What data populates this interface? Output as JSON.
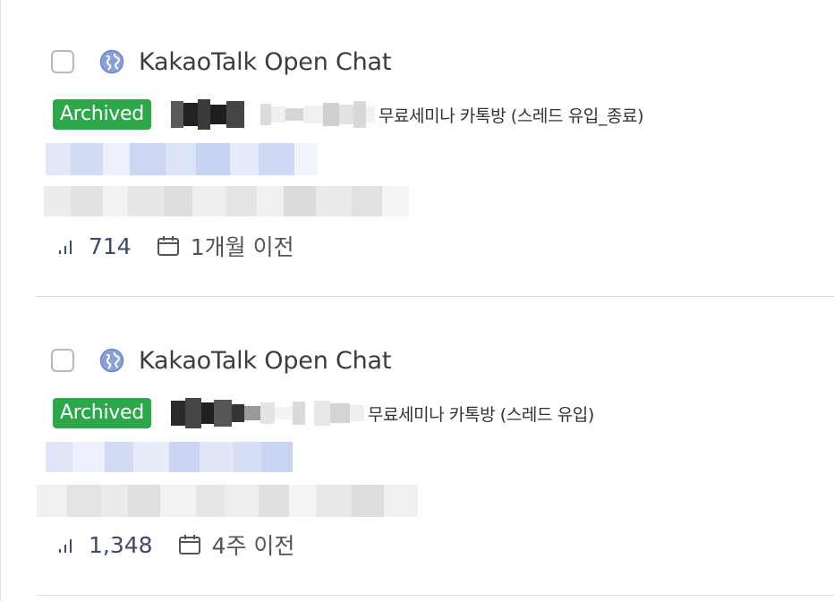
{
  "results": [
    {
      "source": "KakaoTalk Open Chat",
      "badge": "Archived",
      "title_suffix": "무료세미나 카톡방 (스레드 유입_종료)",
      "views": "714",
      "date": "1개월 이전"
    },
    {
      "source": "KakaoTalk Open Chat",
      "badge": "Archived",
      "title_suffix": "무료세미나 카톡방 (스레드 유입)",
      "views": "1,348",
      "date": "4주 이전"
    }
  ],
  "colors": {
    "badge_green": "#2ca84a",
    "globe_blue": "#8aa0d6",
    "count_text": "#3e4a66",
    "divider": "#dcdcdc"
  },
  "icons": {
    "source": "globe-icon",
    "views": "signal-bars-icon",
    "date": "calendar-icon"
  }
}
